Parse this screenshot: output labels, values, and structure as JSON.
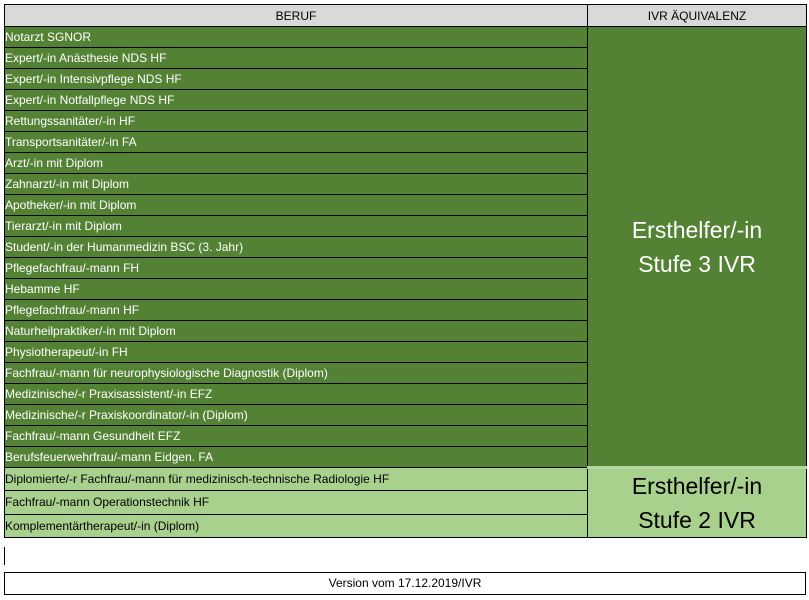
{
  "header": {
    "col_beruf": "BERUF",
    "col_ivr": "IVR ÄQUIVALENZ"
  },
  "level3": {
    "color": "#548235",
    "label_line1": "Ersthelfer/-in",
    "label_line2": "Stufe 3 IVR",
    "rows": [
      "Notarzt SGNOR",
      "Expert/-in Anästhesie NDS HF",
      "Expert/-in Intensivpflege NDS HF",
      "Expert/-in Notfallpflege NDS HF",
      "Rettungssanitäter/-in HF",
      "Transportsanitäter/-in FA",
      "Arzt/-in mit Diplom",
      "Zahnarzt/-in mit Diplom",
      "Apotheker/-in mit Diplom",
      "Tierarzt/-in mit Diplom",
      "Student/-in der Humanmedizin BSC (3. Jahr)",
      "Pflegefachfrau/-mann FH",
      "Hebamme HF",
      "Pflegefachfrau/-mann HF",
      "Naturheilpraktiker/-in mit Diplom",
      "Physiotherapeut/-in FH",
      "Fachfrau/-mann für neurophysiologische Diagnostik (Diplom)",
      "Medizinische/-r Praxisassistent/-in EFZ",
      "Medizinische/-r Praxiskoordinator/-in (Diplom)",
      "Fachfrau/-mann Gesundheit EFZ",
      "Berufsfeuerwehrfrau/-mann Eidgen. FA"
    ]
  },
  "level2": {
    "color": "#a9d18e",
    "label_line1": "Ersthelfer/-in",
    "label_line2": "Stufe 2 IVR",
    "rows": [
      "Diplomierte/-r Fachfrau/-mann für medizinisch-technische Radiologie HF",
      "Fachfrau/-mann Operationstechnik HF",
      "Komplementärtherapeut/-in (Diplom)"
    ]
  },
  "footer": {
    "version": "Version vom 17.12.2019/IVR"
  }
}
